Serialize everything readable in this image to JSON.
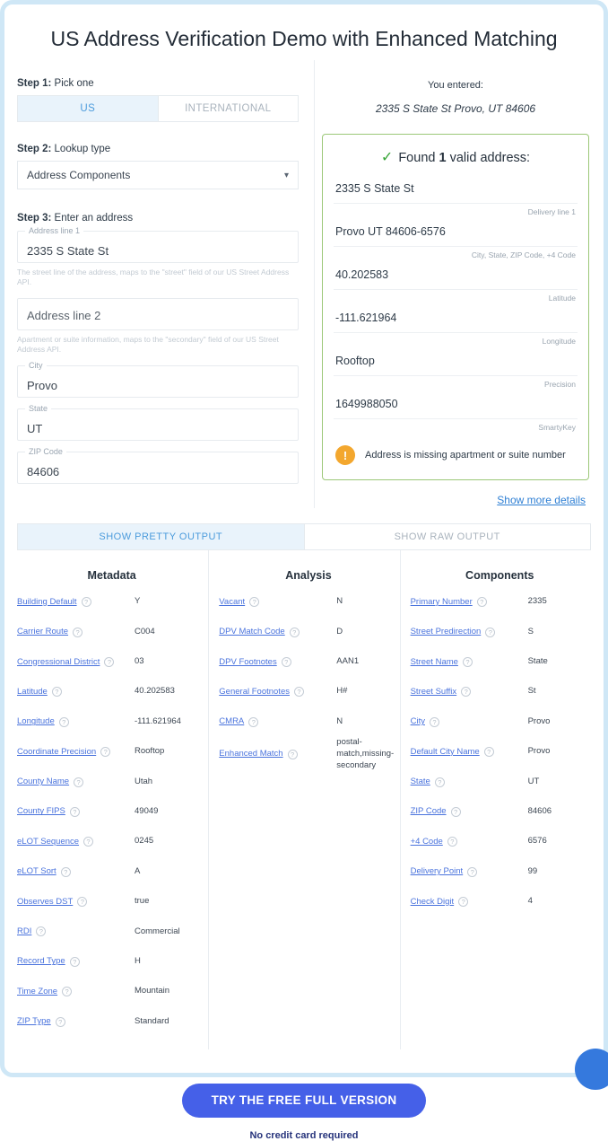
{
  "icons": {
    "check": "✓",
    "warning": "!",
    "caret": "▾",
    "help": "?"
  },
  "page": {
    "title": "US Address Verification Demo with Enhanced Matching"
  },
  "form": {
    "step1_bold": "Step 1:",
    "step1_rest": " Pick one",
    "country_tabs": [
      {
        "label": "US"
      },
      {
        "label": "INTERNATIONAL"
      }
    ],
    "step2_bold": "Step 2:",
    "step2_rest": " Lookup type",
    "lookup_type_value": "Address Components",
    "step3_bold": "Step 3:",
    "step3_rest": " Enter an address",
    "address1": {
      "label": "Address line 1",
      "value": "2335 S State St",
      "helper": "The street line of the address, maps to the \"street\" field of our US Street Address API."
    },
    "address2": {
      "placeholder": "Address line 2",
      "helper": "Apartment or suite information, maps to the \"secondary\" field of our US Street Address API."
    },
    "city": {
      "label": "City",
      "value": "Provo"
    },
    "state": {
      "label": "State",
      "value": "UT"
    },
    "zip": {
      "label": "ZIP Code",
      "value": "84606"
    }
  },
  "result": {
    "you_entered_label": "You entered:",
    "entered_address": "2335 S State St Provo, UT 84606",
    "found_prefix": "Found ",
    "found_count": "1",
    "found_suffix": " valid address:",
    "rows": [
      {
        "value": "2335 S State St",
        "label": "Delivery line 1"
      },
      {
        "value": "Provo UT 84606-6576",
        "label": "City, State, ZIP Code, +4 Code"
      },
      {
        "value": "40.202583",
        "label": "Latitude"
      },
      {
        "value": "-111.621964",
        "label": "Longitude"
      },
      {
        "value": "Rooftop",
        "label": "Precision"
      },
      {
        "value": "1649988050",
        "label": "SmartyKey"
      }
    ],
    "warning_text": "Address is missing apartment or suite number",
    "show_more_label": "Show more details"
  },
  "output_tabs": [
    {
      "label": "SHOW PRETTY OUTPUT"
    },
    {
      "label": "SHOW RAW OUTPUT"
    }
  ],
  "output_columns": [
    {
      "title": "Metadata",
      "rows": [
        {
          "label": "Building Default",
          "value": "Y"
        },
        {
          "label": "Carrier Route",
          "value": "C004"
        },
        {
          "label": "Congressional District",
          "value": "03"
        },
        {
          "label": "Latitude",
          "value": "40.202583"
        },
        {
          "label": "Longitude",
          "value": "-111.621964"
        },
        {
          "label": "Coordinate Precision",
          "value": "Rooftop"
        },
        {
          "label": "County Name",
          "value": "Utah"
        },
        {
          "label": "County FIPS",
          "value": "49049"
        },
        {
          "label": "eLOT Sequence",
          "value": "0245"
        },
        {
          "label": "eLOT Sort",
          "value": "A"
        },
        {
          "label": "Observes DST",
          "value": "true"
        },
        {
          "label": "RDI",
          "value": "Commercial"
        },
        {
          "label": "Record Type",
          "value": "H"
        },
        {
          "label": "Time Zone",
          "value": "Mountain"
        },
        {
          "label": "ZIP Type",
          "value": "Standard"
        }
      ]
    },
    {
      "title": "Analysis",
      "rows": [
        {
          "label": "Vacant",
          "value": "N"
        },
        {
          "label": "DPV Match Code",
          "value": "D"
        },
        {
          "label": "DPV Footnotes",
          "value": "AAN1"
        },
        {
          "label": "General Footnotes",
          "value": "H#"
        },
        {
          "label": "CMRA",
          "value": "N"
        },
        {
          "label": "Enhanced Match",
          "value": "postal-match,missing-secondary"
        }
      ]
    },
    {
      "title": "Components",
      "rows": [
        {
          "label": "Primary Number",
          "value": "2335"
        },
        {
          "label": "Street Predirection",
          "value": "S"
        },
        {
          "label": "Street Name",
          "value": "State"
        },
        {
          "label": "Street Suffix",
          "value": "St"
        },
        {
          "label": "City",
          "value": "Provo"
        },
        {
          "label": "Default City Name",
          "value": "Provo"
        },
        {
          "label": "State",
          "value": "UT"
        },
        {
          "label": "ZIP Code",
          "value": "84606"
        },
        {
          "label": "+4 Code",
          "value": "6576"
        },
        {
          "label": "Delivery Point",
          "value": "99"
        },
        {
          "label": "Check Digit",
          "value": "4"
        }
      ]
    }
  ],
  "footer": {
    "cta_label": "TRY THE FREE FULL VERSION",
    "note": "No credit card required"
  },
  "colors": {
    "accent_blue": "#4b9bdc",
    "link_blue": "#4a73dd",
    "button_blue": "#4560e8",
    "success_green": "#37a537",
    "result_border_green": "#9cc878",
    "warning_orange": "#f3a72e",
    "page_border": "#cfe7f6"
  }
}
